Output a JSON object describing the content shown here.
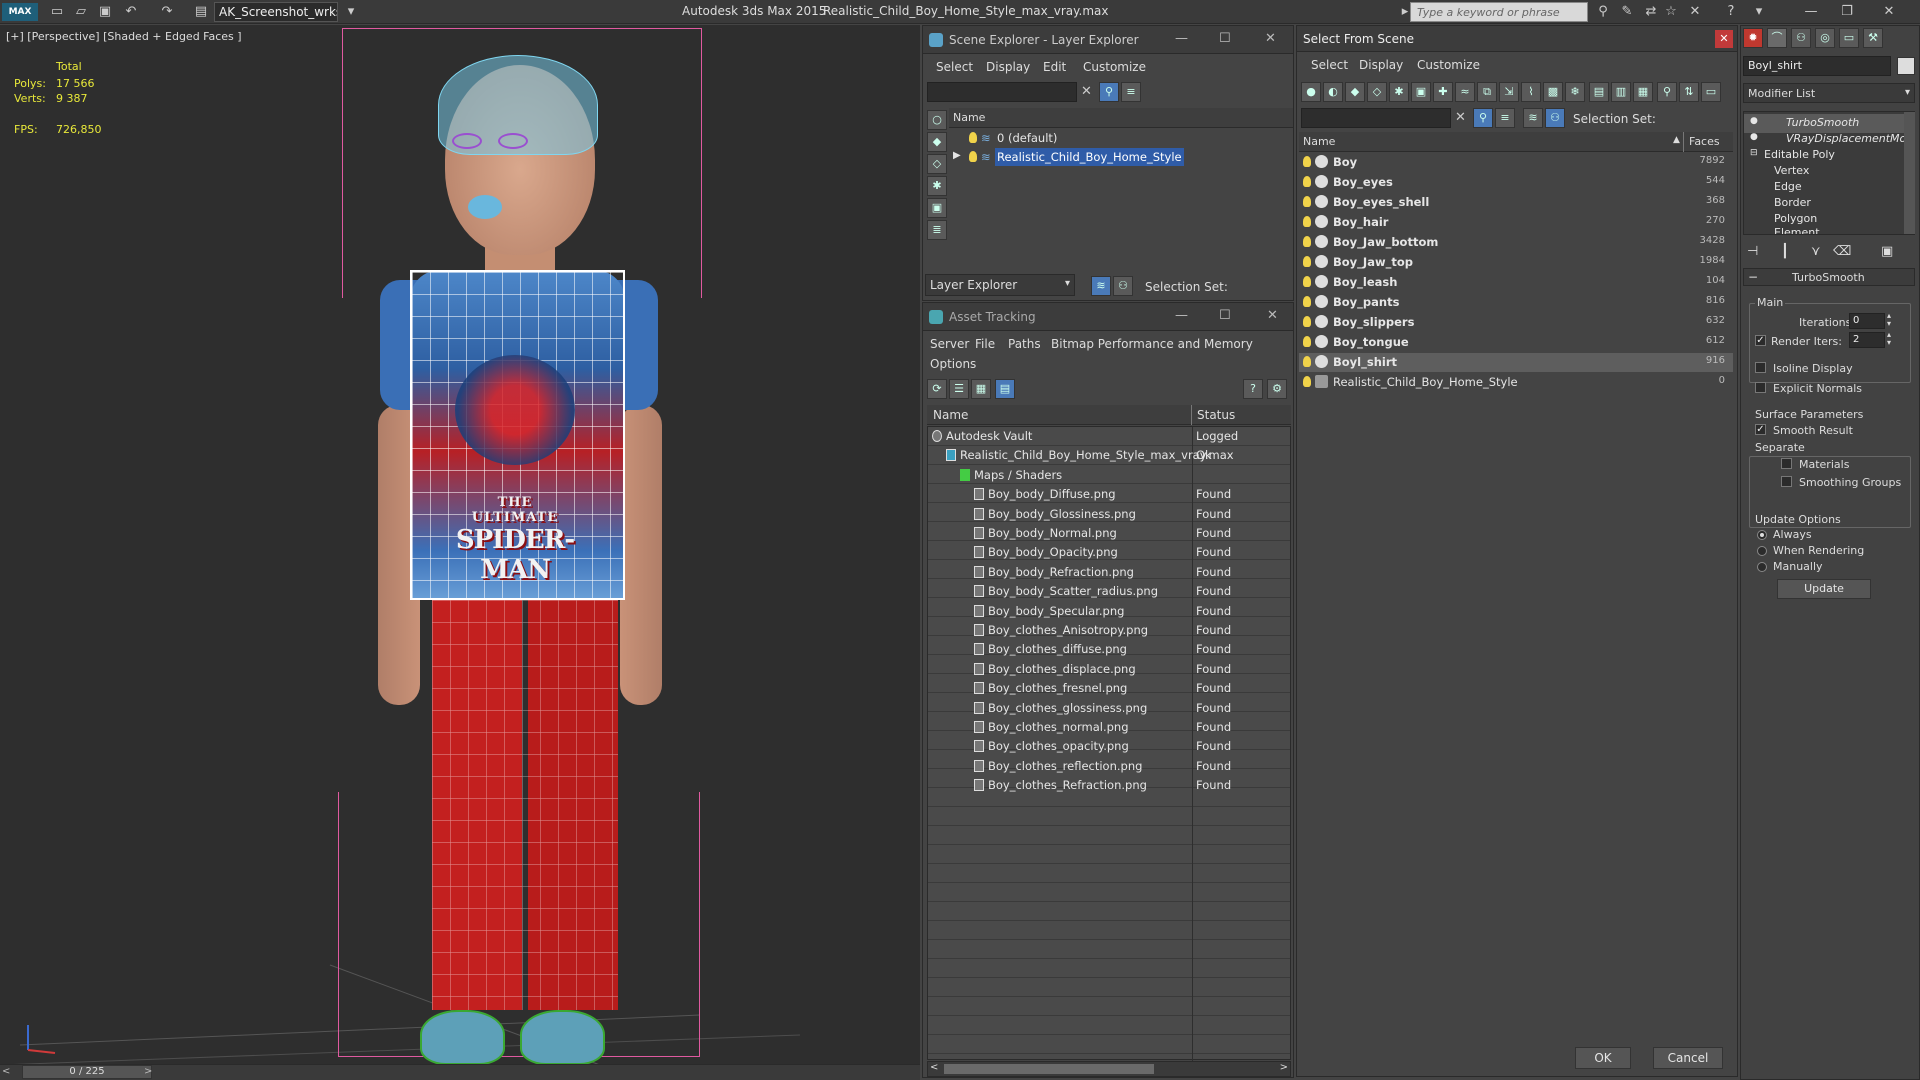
{
  "titlebar": {
    "app_title": "Autodesk 3ds Max  2015",
    "file_title": "Realistic_Child_Boy_Home_Style_max_vray.max",
    "workspace": "AK_Screenshot_wrksp",
    "search_placeholder": "Type a keyword or phrase",
    "logo_text": "MAX"
  },
  "viewport": {
    "label": "[+] [Perspective] [Shaded + Edged Faces ]",
    "stats": {
      "total_label": "Total",
      "polys_label": "Polys:",
      "polys_value": "17 566",
      "verts_label": "Verts:",
      "verts_value": "9 387",
      "fps_label": "FPS:",
      "fps_value": "726,850"
    },
    "shirt_small": "THE",
    "shirt_top": "ULTIMATE",
    "shirt_main": "SPIDER-MAN",
    "timeline": "0 / 225"
  },
  "scene_explorer": {
    "title": "Scene Explorer - Layer Explorer",
    "menu": [
      "Select",
      "Display",
      "Edit",
      "Customize"
    ],
    "col_name": "Name",
    "layers": [
      "0 (default)",
      "Realistic_Child_Boy_Home_Style"
    ],
    "footer_dropdown": "Layer Explorer",
    "selection_set_label": "Selection Set:"
  },
  "asset_tracking": {
    "title": "Asset Tracking",
    "menu": [
      "Server",
      "File",
      "Paths",
      "Bitmap Performance and Memory"
    ],
    "menu2": "Options",
    "col_name": "Name",
    "col_status": "Status",
    "rows": [
      {
        "name": "Autodesk Vault",
        "status": "Logged"
      },
      {
        "name": "Realistic_Child_Boy_Home_Style_max_vray.max",
        "status": "Ok"
      },
      {
        "name": "Maps / Shaders",
        "status": ""
      },
      {
        "name": "Boy_body_Diffuse.png",
        "status": "Found"
      },
      {
        "name": "Boy_body_Glossiness.png",
        "status": "Found"
      },
      {
        "name": "Boy_body_Normal.png",
        "status": "Found"
      },
      {
        "name": "Boy_body_Opacity.png",
        "status": "Found"
      },
      {
        "name": "Boy_body_Refraction.png",
        "status": "Found"
      },
      {
        "name": "Boy_body_Scatter_radius.png",
        "status": "Found"
      },
      {
        "name": "Boy_body_Specular.png",
        "status": "Found"
      },
      {
        "name": "Boy_clothes_Anisotropy.png",
        "status": "Found"
      },
      {
        "name": "Boy_clothes_diffuse.png",
        "status": "Found"
      },
      {
        "name": "Boy_clothes_displace.png",
        "status": "Found"
      },
      {
        "name": "Boy_clothes_fresnel.png",
        "status": "Found"
      },
      {
        "name": "Boy_clothes_glossiness.png",
        "status": "Found"
      },
      {
        "name": "Boy_clothes_normal.png",
        "status": "Found"
      },
      {
        "name": "Boy_clothes_opacity.png",
        "status": "Found"
      },
      {
        "name": "Boy_clothes_reflection.png",
        "status": "Found"
      },
      {
        "name": "Boy_clothes_Refraction.png",
        "status": "Found"
      }
    ]
  },
  "select_from_scene": {
    "title": "Select From Scene",
    "menu": [
      "Select",
      "Display",
      "Customize"
    ],
    "selection_set_label": "Selection Set:",
    "col_name": "Name",
    "col_faces": "Faces",
    "objects": [
      {
        "name": "Boy",
        "faces": "7892"
      },
      {
        "name": "Boy_eyes",
        "faces": "544"
      },
      {
        "name": "Boy_eyes_shell",
        "faces": "368"
      },
      {
        "name": "Boy_hair",
        "faces": "270"
      },
      {
        "name": "Boy_Jaw_bottom",
        "faces": "3428"
      },
      {
        "name": "Boy_Jaw_top",
        "faces": "1984"
      },
      {
        "name": "Boy_leash",
        "faces": "104"
      },
      {
        "name": "Boy_pants",
        "faces": "816"
      },
      {
        "name": "Boy_slippers",
        "faces": "632"
      },
      {
        "name": "Boy_tongue",
        "faces": "612"
      },
      {
        "name": "Boyl_shirt",
        "faces": "916"
      },
      {
        "name": "Realistic_Child_Boy_Home_Style",
        "faces": "0"
      }
    ],
    "ok": "OK",
    "cancel": "Cancel"
  },
  "modify_panel": {
    "object_name": "Boyl_shirt",
    "modifier_list": "Modifier List",
    "stack": [
      "TurboSmooth",
      "VRayDisplacementMo",
      "Editable Poly",
      "Vertex",
      "Edge",
      "Border",
      "Polygon",
      "Element"
    ],
    "rollout_title": "TurboSmooth",
    "main_label": "Main",
    "iterations_label": "Iterations:",
    "iterations_value": "0",
    "render_iters_label": "Render Iters:",
    "render_iters_value": "2",
    "isoline_label": "Isoline Display",
    "explicit_normals_label": "Explicit Normals",
    "surface_params_label": "Surface Parameters",
    "smooth_result_label": "Smooth Result",
    "separate_label": "Separate",
    "materials_label": "Materials",
    "smoothing_groups_label": "Smoothing Groups",
    "update_options_label": "Update Options",
    "always_label": "Always",
    "when_rendering_label": "When Rendering",
    "manually_label": "Manually",
    "update_button": "Update"
  }
}
